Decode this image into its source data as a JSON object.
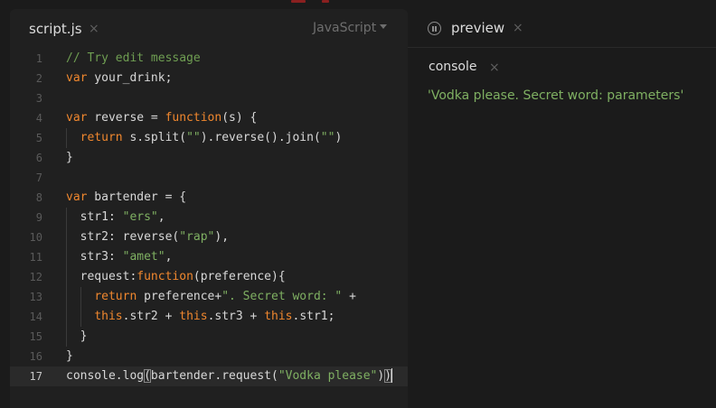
{
  "editor": {
    "tab_name": "script.js",
    "tab_close": "×",
    "language": "JavaScript",
    "active_line": 17
  },
  "code_lines": [
    {
      "n": "1",
      "tokens": [
        {
          "t": "// Try edit message",
          "c": "cm"
        }
      ]
    },
    {
      "n": "2",
      "tokens": [
        {
          "t": "var",
          "c": "kw"
        },
        {
          "t": " your_drink;",
          "c": ""
        }
      ]
    },
    {
      "n": "3",
      "tokens": []
    },
    {
      "n": "4",
      "tokens": [
        {
          "t": "var",
          "c": "kw"
        },
        {
          "t": " reverse = ",
          "c": ""
        },
        {
          "t": "function",
          "c": "kw"
        },
        {
          "t": "(s) {",
          "c": ""
        }
      ]
    },
    {
      "n": "5",
      "indent": 1,
      "tokens": [
        {
          "t": "  ",
          "c": ""
        },
        {
          "t": "return",
          "c": "kw"
        },
        {
          "t": " s.split(",
          "c": ""
        },
        {
          "t": "\"\"",
          "c": "str"
        },
        {
          "t": ").reverse().join(",
          "c": ""
        },
        {
          "t": "\"\"",
          "c": "str"
        },
        {
          "t": ")",
          "c": ""
        }
      ]
    },
    {
      "n": "6",
      "tokens": [
        {
          "t": "}",
          "c": ""
        }
      ]
    },
    {
      "n": "7",
      "tokens": []
    },
    {
      "n": "8",
      "tokens": [
        {
          "t": "var",
          "c": "kw"
        },
        {
          "t": " bartender = {",
          "c": ""
        }
      ]
    },
    {
      "n": "9",
      "indent": 1,
      "tokens": [
        {
          "t": "  str1: ",
          "c": ""
        },
        {
          "t": "\"ers\"",
          "c": "str"
        },
        {
          "t": ",",
          "c": ""
        }
      ]
    },
    {
      "n": "10",
      "indent": 1,
      "tokens": [
        {
          "t": "  str2: reverse(",
          "c": ""
        },
        {
          "t": "\"rap\"",
          "c": "str"
        },
        {
          "t": "),",
          "c": ""
        }
      ]
    },
    {
      "n": "11",
      "indent": 1,
      "tokens": [
        {
          "t": "  str3: ",
          "c": ""
        },
        {
          "t": "\"amet\"",
          "c": "str"
        },
        {
          "t": ",",
          "c": ""
        }
      ]
    },
    {
      "n": "12",
      "indent": 1,
      "tokens": [
        {
          "t": "  request:",
          "c": ""
        },
        {
          "t": "function",
          "c": "kw"
        },
        {
          "t": "(preference){",
          "c": ""
        }
      ]
    },
    {
      "n": "13",
      "indent": 2,
      "tokens": [
        {
          "t": "    ",
          "c": ""
        },
        {
          "t": "return",
          "c": "kw"
        },
        {
          "t": " preference+",
          "c": ""
        },
        {
          "t": "\". Secret word: \"",
          "c": "str"
        },
        {
          "t": " +",
          "c": ""
        }
      ]
    },
    {
      "n": "14",
      "indent": 2,
      "tokens": [
        {
          "t": "    ",
          "c": ""
        },
        {
          "t": "this",
          "c": "kw"
        },
        {
          "t": ".str2 + ",
          "c": ""
        },
        {
          "t": "this",
          "c": "kw"
        },
        {
          "t": ".str3 + ",
          "c": ""
        },
        {
          "t": "this",
          "c": "kw"
        },
        {
          "t": ".str1;",
          "c": ""
        }
      ]
    },
    {
      "n": "15",
      "indent": 1,
      "tokens": [
        {
          "t": "  }",
          "c": ""
        }
      ]
    },
    {
      "n": "16",
      "tokens": [
        {
          "t": "}",
          "c": ""
        }
      ]
    },
    {
      "n": "17",
      "tokens": [
        {
          "t": "console.log",
          "c": ""
        },
        {
          "t": "(",
          "c": "",
          "hl": true
        },
        {
          "t": "bartender.request(",
          "c": ""
        },
        {
          "t": "\"Vodka please\"",
          "c": "str"
        },
        {
          "t": ")",
          "c": ""
        },
        {
          "t": ")",
          "c": "",
          "hl": true
        },
        {
          "t": "",
          "c": "",
          "cursor": true
        }
      ]
    }
  ],
  "preview": {
    "tab_name": "preview",
    "tab_close": "×",
    "icon": "pause-circle-icon"
  },
  "console": {
    "tab_name": "console",
    "tab_close": "×",
    "output": "'Vodka please. Secret word: parameters'"
  },
  "colors": {
    "keyword": "#f0872e",
    "string": "#7fb062",
    "comment": "#6f9e52",
    "text": "#d8d8d8",
    "background": "#1b1b1b",
    "editor_background": "#202020"
  }
}
